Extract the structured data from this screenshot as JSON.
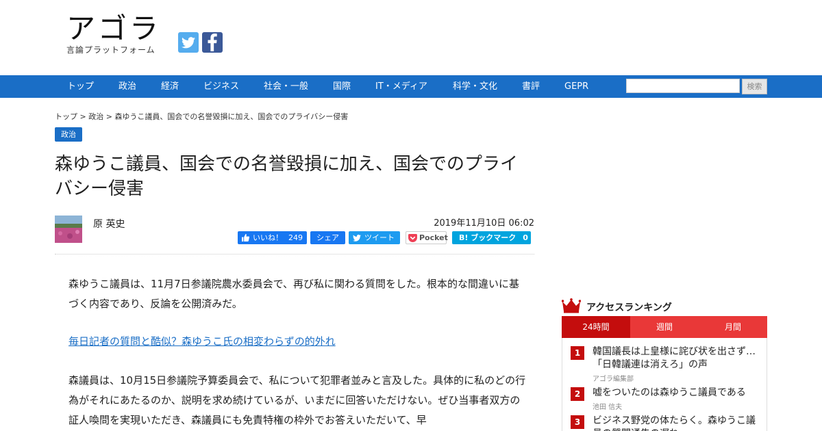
{
  "site": {
    "logo_title": "アゴラ",
    "logo_subtitle": "言論プラットフォーム"
  },
  "nav": {
    "items": [
      "トップ",
      "政治",
      "経済",
      "ビジネス",
      "社会・一般",
      "国際",
      "IT・メディア",
      "科学・文化",
      "書評",
      "GEPR"
    ],
    "search_placeholder": "",
    "search_label": "検索"
  },
  "breadcrumb": {
    "home": "トップ",
    "sep1": " > ",
    "category": "政治",
    "sep2": " > ",
    "current": "森ゆうこ議員、国会での名誉毀損に加え、国会でのプライバシー侵害"
  },
  "article": {
    "category_badge": "政治",
    "title": "森ゆうこ議員、国会での名誉毀損に加え、国会でのプライバシー侵害",
    "author": "原 英史",
    "date": "2019年11月10日 06:02",
    "share": {
      "like_label": "いいね！",
      "like_count": "249",
      "share_label": "シェア",
      "tweet_label": "ツイート",
      "pocket_label": "Pocket",
      "hatena_label": "B! ブックマーク",
      "hatena_count": "0"
    },
    "paragraph1": "森ゆうこ議員は、11月7日参議院農水委員会で、再び私に関わる質問をした。根本的な間違いに基づく内容であり、反論を公開済みだ。",
    "link": "毎日記者の質問と酷似？森ゆうこ氏の相変わらずの的外れ",
    "paragraph2": "森議員は、10月15日参議院予算委員会で、私について犯罪者並みと言及した。具体的に私のどの行為がそれにあたるのか、説明を求め続けているが、いまだに回答いただけない。ぜひ当事者双方の証人喚問を実現いただき、森議員にも免責特権の枠外でお答えいただいて、早"
  },
  "ranking": {
    "heading": "アクセスランキング",
    "tabs": [
      "24時間",
      "週間",
      "月間"
    ],
    "active_tab": "24時間",
    "items": [
      {
        "rank": "1",
        "title": "韓国議長は上皇様に詫び状を出さず…「日韓議連は消えろ」の声",
        "author": "アゴラ編集部"
      },
      {
        "rank": "2",
        "title": "嘘をついたのは森ゆうこ議員である",
        "author": "池田 信夫"
      },
      {
        "rank": "3",
        "title": "ビジネス野党の体たらく。森ゆうこ議員の質問通告の遅れ",
        "author": ""
      }
    ]
  },
  "colors": {
    "nav_blue": "#1a6ec6",
    "ranking_red": "#e93838",
    "ranking_dark_red": "#c40d0d",
    "twitter": "#55acee",
    "facebook": "#3b5998"
  }
}
